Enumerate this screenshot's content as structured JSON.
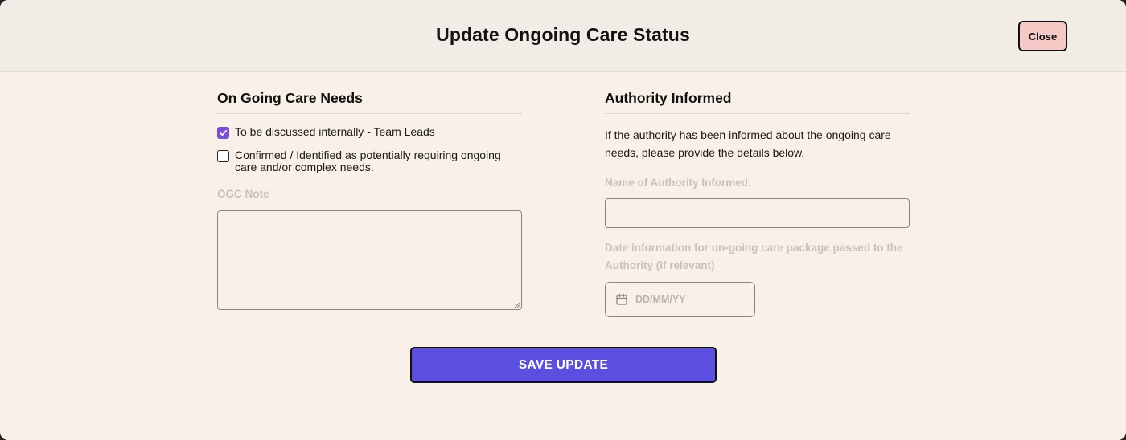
{
  "modal": {
    "title": "Update Ongoing Care Status",
    "close_label": "Close"
  },
  "care_needs": {
    "title": "On Going Care Needs",
    "options": [
      {
        "label": "To be discussed internally - Team Leads",
        "checked": true
      },
      {
        "label": "Confirmed / Identified as potentially requiring ongoing care and/or complex needs.",
        "checked": false
      }
    ],
    "note_label": "OGC Note",
    "note_value": ""
  },
  "authority": {
    "title": "Authority Informed",
    "description": "If the authority has been informed about the ongoing care needs, please provide the details below.",
    "name_label": "Name of Authority Informed:",
    "name_value": "",
    "date_label": "Date information for on-going care package passed to the Authority (if relevant)",
    "date_placeholder": "DD/MM/YY",
    "date_icon": "calendar-icon"
  },
  "actions": {
    "save_label": "SAVE UPDATE"
  },
  "colors": {
    "accent": "#5b4fe0",
    "checkbox_checked": "#7c4ddb",
    "close_bg": "#f6c9c6",
    "page_bg": "#f9f0e7",
    "header_bg": "#f1ece5"
  }
}
